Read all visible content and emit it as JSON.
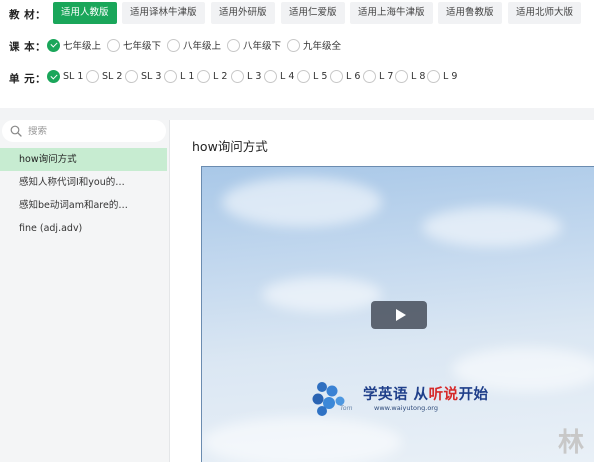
{
  "filters": {
    "textbook_label": "教 材：",
    "textbooks": [
      {
        "label": "适用人教版",
        "active": true
      },
      {
        "label": "适用译林牛津版",
        "active": false
      },
      {
        "label": "适用外研版",
        "active": false
      },
      {
        "label": "适用仁爱版",
        "active": false
      },
      {
        "label": "适用上海牛津版",
        "active": false
      },
      {
        "label": "适用鲁教版",
        "active": false
      },
      {
        "label": "适用北师大版",
        "active": false
      }
    ],
    "lesson_label": "课 本：",
    "lessons": [
      {
        "label": "七年级上",
        "checked": true
      },
      {
        "label": "七年级下",
        "checked": false
      },
      {
        "label": "八年级上",
        "checked": false
      },
      {
        "label": "八年级下",
        "checked": false
      },
      {
        "label": "九年级全",
        "checked": false
      }
    ],
    "unit_label": "单 元：",
    "units": [
      {
        "label": "SL 1",
        "checked": true
      },
      {
        "label": "SL 2",
        "checked": false
      },
      {
        "label": "SL 3",
        "checked": false
      },
      {
        "label": "L 1",
        "checked": false
      },
      {
        "label": "L 2",
        "checked": false
      },
      {
        "label": "L 3",
        "checked": false
      },
      {
        "label": "L 4",
        "checked": false
      },
      {
        "label": "L 5",
        "checked": false
      },
      {
        "label": "L 6",
        "checked": false
      },
      {
        "label": "L 7",
        "checked": false
      },
      {
        "label": "L 8",
        "checked": false
      },
      {
        "label": "L 9",
        "checked": false
      }
    ]
  },
  "sidebar": {
    "search_placeholder": "搜索",
    "search_value": "",
    "items": [
      {
        "label": "how询问方式",
        "active": true
      },
      {
        "label": "感知人称代词I和you的…",
        "active": false
      },
      {
        "label": "感知be动词am和are的…",
        "active": false
      },
      {
        "label": "fine (adj.adv)",
        "active": false
      }
    ]
  },
  "main": {
    "title": "how询问方式",
    "video": {
      "brand_mark": "Tom",
      "slogan_part1": "学英语 从",
      "slogan_part2": "听说",
      "slogan_part3": "开始",
      "website": "www.waiyutong.org"
    }
  },
  "watermark": "林",
  "colors": {
    "accent": "#1aa65a",
    "active_item_bg": "#c7ecd1",
    "slogan_blue": "#1f3f8a",
    "slogan_red": "#d62a2a"
  }
}
